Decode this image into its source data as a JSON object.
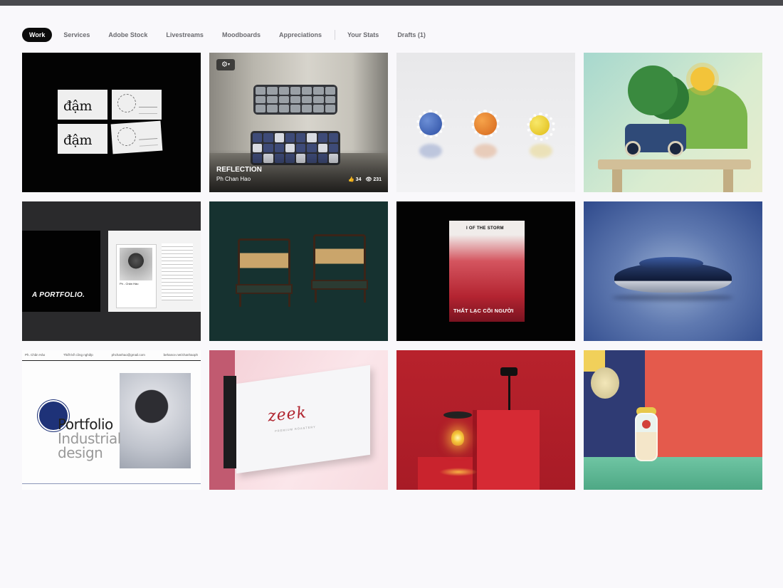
{
  "tabs": [
    {
      "label": "Work",
      "active": true
    },
    {
      "label": "Services",
      "active": false
    },
    {
      "label": "Adobe Stock",
      "active": false
    },
    {
      "label": "Livestreams",
      "active": false
    },
    {
      "label": "Moodboards",
      "active": false
    },
    {
      "label": "Appreciations",
      "active": false
    }
  ],
  "tabs_secondary": [
    {
      "label": "Your Stats"
    },
    {
      "label": "Drafts (1)"
    }
  ],
  "projects": {
    "p1": {
      "art_word_a": "đậm",
      "art_word_b": "đậm"
    },
    "p2": {
      "title": "REFLECTION",
      "owner": "Ph Chan Hao",
      "likes": "34",
      "views": "231",
      "settings_icon": "gear-icon"
    },
    "p5": {
      "cover_text": "A PORTFOLIO.",
      "card_name": "Ph - Chân Hảo"
    },
    "p7": {
      "poster_title": "I OF THE STORM",
      "poster_caption": "THẤT LẠC CÕI NGƯỜI"
    },
    "p9": {
      "header_left": "Ph. Chân Hảo",
      "header_mid": "Thiết kế công nghiệp",
      "header_email": "phchanhao@gmail.com",
      "header_right": "behance.net/chanhaoph",
      "word1": "Portfolio",
      "word2": "Industrial",
      "word3": "design"
    },
    "p10": {
      "logo_text": "zeek",
      "tagline": "PREMIUM ROASTERY"
    }
  },
  "colors": {
    "active_tab_bg": "#0b0b0b",
    "page_bg": "#f9f8fb",
    "top_bar": "#4a4a4e"
  }
}
